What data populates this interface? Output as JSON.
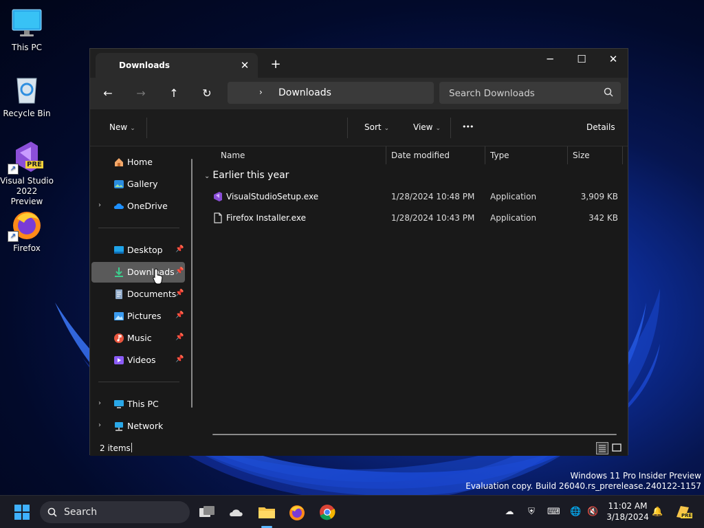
{
  "desktop": {
    "icons": [
      {
        "label": "This PC"
      },
      {
        "label": "Recycle Bin"
      },
      {
        "label": "Visual Studio 2022 Preview",
        "badge": "PRE"
      },
      {
        "label": "Firefox"
      }
    ],
    "watermark": {
      "line1": "Windows 11 Pro Insider Preview",
      "line2": "Evaluation copy. Build 26040.rs_prerelease.240122-1157"
    }
  },
  "window": {
    "tab_title": "Downloads",
    "tab_close": "✕",
    "new_tab": "+",
    "controls": {
      "minimize": "─",
      "maximize": "☐",
      "close": "✕"
    },
    "nav": {
      "back": "←",
      "forward": "→",
      "up": "↑",
      "refresh": "↻"
    },
    "address": {
      "chevron": "›",
      "path": "Downloads"
    },
    "search": {
      "placeholder": "Search Downloads"
    },
    "commands": {
      "new": "New",
      "sort": "Sort",
      "view": "View",
      "more": "•••",
      "details": "Details"
    },
    "sidebar": {
      "top": [
        {
          "label": "Home",
          "expander": ""
        },
        {
          "label": "Gallery",
          "expander": ""
        },
        {
          "label": "OneDrive",
          "expander": "›"
        }
      ],
      "pinned": [
        {
          "label": "Desktop",
          "pin": "📌"
        },
        {
          "label": "Downloads",
          "pin": "📌"
        },
        {
          "label": "Documents",
          "pin": "📌"
        },
        {
          "label": "Pictures",
          "pin": "📌"
        },
        {
          "label": "Music",
          "pin": "📌"
        },
        {
          "label": "Videos",
          "pin": "📌"
        }
      ],
      "bottom": [
        {
          "label": "This PC",
          "expander": "›"
        },
        {
          "label": "Network",
          "expander": "›"
        }
      ]
    },
    "columns": {
      "name": "Name",
      "date": "Date modified",
      "type": "Type",
      "size": "Size"
    },
    "group": {
      "label": "Earlier this year",
      "chevron": "⌄"
    },
    "files": [
      {
        "name": "VisualStudioSetup.exe",
        "date": "1/28/2024 10:48 PM",
        "type": "Application",
        "size": "3,909 KB"
      },
      {
        "name": "Firefox Installer.exe",
        "date": "1/28/2024 10:43 PM",
        "type": "Application",
        "size": "342 KB"
      }
    ],
    "status": "2 items"
  },
  "taskbar": {
    "search_label": "Search",
    "clock": {
      "time": "11:02 AM",
      "date": "3/18/2024"
    },
    "tray_badge": "PRE"
  }
}
